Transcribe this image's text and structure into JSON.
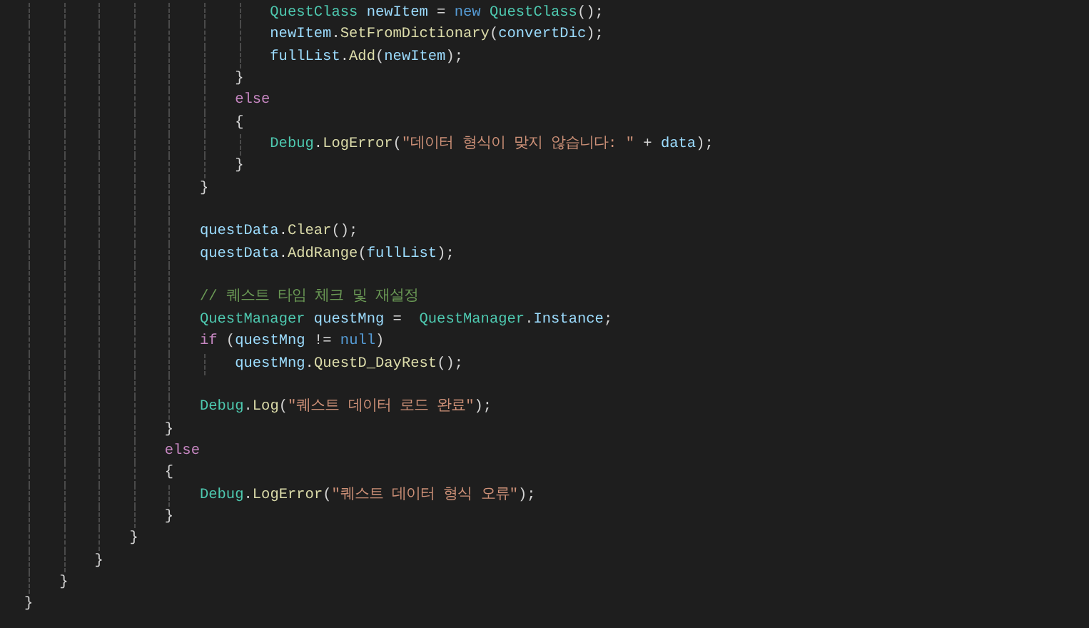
{
  "editor": {
    "lines": [
      {
        "kind": "code",
        "tokens": [
          {
            "kind": "type",
            "text": "                            QuestClass"
          },
          {
            "kind": "var",
            "text": " newItem"
          },
          {
            "kind": "punct",
            "text": " = "
          },
          {
            "kind": "keyword",
            "text": "new"
          },
          {
            "kind": "type",
            "text": " QuestClass"
          },
          {
            "kind": "punct",
            "text": "();"
          }
        ]
      },
      {
        "kind": "code",
        "tokens": [
          {
            "kind": "var",
            "text": "                            newItem"
          },
          {
            "kind": "punct",
            "text": "."
          },
          {
            "kind": "method",
            "text": "SetFromDictionary"
          },
          {
            "kind": "punct",
            "text": "("
          },
          {
            "kind": "var",
            "text": "convertDic"
          },
          {
            "kind": "punct",
            "text": ");"
          }
        ]
      },
      {
        "kind": "code",
        "tokens": [
          {
            "kind": "var",
            "text": "                            fullList"
          },
          {
            "kind": "punct",
            "text": "."
          },
          {
            "kind": "method",
            "text": "Add"
          },
          {
            "kind": "punct",
            "text": "("
          },
          {
            "kind": "var",
            "text": "newItem"
          },
          {
            "kind": "punct",
            "text": ");"
          }
        ]
      },
      {
        "kind": "code",
        "tokens": [
          {
            "kind": "punct",
            "text": "                        }"
          }
        ]
      },
      {
        "kind": "code",
        "tokens": [
          {
            "kind": "control",
            "text": "                        else"
          }
        ]
      },
      {
        "kind": "code",
        "tokens": [
          {
            "kind": "punct",
            "text": "                        {"
          }
        ]
      },
      {
        "kind": "code",
        "tokens": [
          {
            "kind": "type",
            "text": "                            Debug"
          },
          {
            "kind": "punct",
            "text": "."
          },
          {
            "kind": "method",
            "text": "LogError"
          },
          {
            "kind": "punct",
            "text": "("
          },
          {
            "kind": "string",
            "text": "\"데이터 형식이 맞지 않습니다: \""
          },
          {
            "kind": "punct",
            "text": " + "
          },
          {
            "kind": "var",
            "text": "data"
          },
          {
            "kind": "punct",
            "text": ");"
          }
        ]
      },
      {
        "kind": "code",
        "tokens": [
          {
            "kind": "punct",
            "text": "                        }"
          }
        ]
      },
      {
        "kind": "code",
        "tokens": [
          {
            "kind": "punct",
            "text": "                    }"
          }
        ]
      },
      {
        "kind": "blank"
      },
      {
        "kind": "code",
        "tokens": [
          {
            "kind": "var",
            "text": "                    questData"
          },
          {
            "kind": "punct",
            "text": "."
          },
          {
            "kind": "method",
            "text": "Clear"
          },
          {
            "kind": "punct",
            "text": "();"
          }
        ]
      },
      {
        "kind": "code",
        "tokens": [
          {
            "kind": "var",
            "text": "                    questData"
          },
          {
            "kind": "punct",
            "text": "."
          },
          {
            "kind": "method",
            "text": "AddRange"
          },
          {
            "kind": "punct",
            "text": "("
          },
          {
            "kind": "var",
            "text": "fullList"
          },
          {
            "kind": "punct",
            "text": ");"
          }
        ]
      },
      {
        "kind": "blank"
      },
      {
        "kind": "code",
        "tokens": [
          {
            "kind": "comment",
            "text": "                    // 퀘스트 타임 체크 및 재설정"
          }
        ]
      },
      {
        "kind": "code",
        "tokens": [
          {
            "kind": "type",
            "text": "                    QuestManager"
          },
          {
            "kind": "var",
            "text": " questMng"
          },
          {
            "kind": "punct",
            "text": " =  "
          },
          {
            "kind": "type",
            "text": "QuestManager"
          },
          {
            "kind": "punct",
            "text": "."
          },
          {
            "kind": "var",
            "text": "Instance"
          },
          {
            "kind": "punct",
            "text": ";"
          }
        ]
      },
      {
        "kind": "code",
        "tokens": [
          {
            "kind": "control",
            "text": "                    if"
          },
          {
            "kind": "punct",
            "text": " ("
          },
          {
            "kind": "var",
            "text": "questMng"
          },
          {
            "kind": "punct",
            "text": " != "
          },
          {
            "kind": "keyword",
            "text": "null"
          },
          {
            "kind": "punct",
            "text": ")"
          }
        ]
      },
      {
        "kind": "code",
        "tokens": [
          {
            "kind": "var",
            "text": "                        questMng"
          },
          {
            "kind": "punct",
            "text": "."
          },
          {
            "kind": "method",
            "text": "QuestD_DayRest"
          },
          {
            "kind": "punct",
            "text": "();"
          }
        ]
      },
      {
        "kind": "blank"
      },
      {
        "kind": "code",
        "tokens": [
          {
            "kind": "type",
            "text": "                    Debug"
          },
          {
            "kind": "punct",
            "text": "."
          },
          {
            "kind": "method",
            "text": "Log"
          },
          {
            "kind": "punct",
            "text": "("
          },
          {
            "kind": "string",
            "text": "\"퀘스트 데이터 로드 완료\""
          },
          {
            "kind": "punct",
            "text": ");"
          }
        ]
      },
      {
        "kind": "code",
        "tokens": [
          {
            "kind": "punct",
            "text": "                }"
          }
        ]
      },
      {
        "kind": "code",
        "tokens": [
          {
            "kind": "control",
            "text": "                else"
          }
        ]
      },
      {
        "kind": "code",
        "tokens": [
          {
            "kind": "punct",
            "text": "                {"
          }
        ]
      },
      {
        "kind": "code",
        "tokens": [
          {
            "kind": "type",
            "text": "                    Debug"
          },
          {
            "kind": "punct",
            "text": "."
          },
          {
            "kind": "method",
            "text": "LogError"
          },
          {
            "kind": "punct",
            "text": "("
          },
          {
            "kind": "string",
            "text": "\"퀘스트 데이터 형식 오류\""
          },
          {
            "kind": "punct",
            "text": ");"
          }
        ]
      },
      {
        "kind": "code",
        "tokens": [
          {
            "kind": "punct",
            "text": "                }"
          }
        ]
      },
      {
        "kind": "code",
        "tokens": [
          {
            "kind": "punct",
            "text": "            }"
          }
        ]
      },
      {
        "kind": "code",
        "tokens": [
          {
            "kind": "punct",
            "text": "        }"
          }
        ]
      },
      {
        "kind": "code",
        "tokens": [
          {
            "kind": "punct",
            "text": "    }"
          }
        ]
      },
      {
        "kind": "code",
        "tokens": [
          {
            "kind": "punct",
            "text": "}"
          }
        ]
      }
    ]
  }
}
